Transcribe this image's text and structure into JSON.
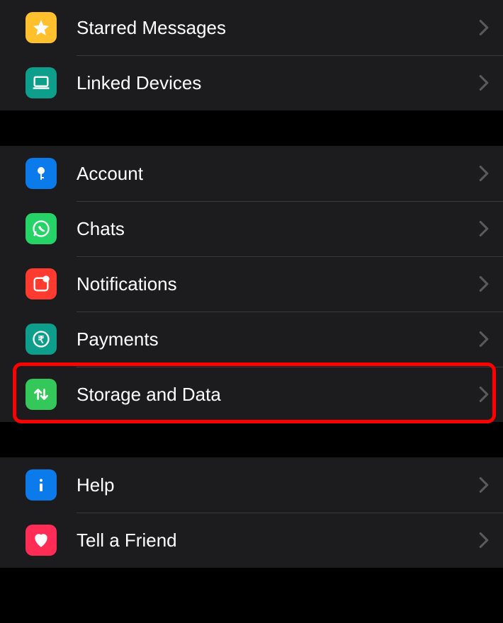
{
  "sections": [
    {
      "items": [
        {
          "id": "starred-messages",
          "label": "Starred Messages",
          "icon": "star-icon",
          "icon_bg": "#FFC02E"
        },
        {
          "id": "linked-devices",
          "label": "Linked Devices",
          "icon": "laptop-icon",
          "icon_bg": "#0E9E8C"
        }
      ]
    },
    {
      "items": [
        {
          "id": "account",
          "label": "Account",
          "icon": "key-icon",
          "icon_bg": "#0B7BEC"
        },
        {
          "id": "chats",
          "label": "Chats",
          "icon": "whatsapp-icon",
          "icon_bg": "#25D366"
        },
        {
          "id": "notifications",
          "label": "Notifications",
          "icon": "notification-badge-icon",
          "icon_bg": "#FF3B30"
        },
        {
          "id": "payments",
          "label": "Payments",
          "icon": "rupee-icon",
          "icon_bg": "#0E9E8C"
        },
        {
          "id": "storage-and-data",
          "label": "Storage and Data",
          "icon": "arrows-up-down-icon",
          "icon_bg": "#34C759",
          "highlighted": true
        }
      ]
    },
    {
      "items": [
        {
          "id": "help",
          "label": "Help",
          "icon": "info-icon",
          "icon_bg": "#0B7BEC"
        },
        {
          "id": "tell-a-friend",
          "label": "Tell a Friend",
          "icon": "heart-icon",
          "icon_bg": "#FF2D55"
        }
      ]
    }
  ]
}
